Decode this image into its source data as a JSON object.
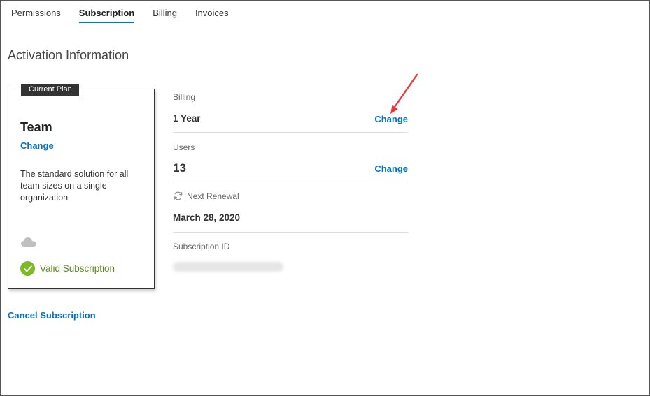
{
  "tabs": [
    {
      "label": "Permissions",
      "active": false
    },
    {
      "label": "Subscription",
      "active": true
    },
    {
      "label": "Billing",
      "active": false
    },
    {
      "label": "Invoices",
      "active": false
    }
  ],
  "page_title": "Activation Information",
  "plan_card": {
    "badge": "Current Plan",
    "name": "Team",
    "change_label": "Change",
    "description": "The standard solution for all team sizes on a single organization",
    "status_icon": "cloud-icon",
    "valid_label": "Valid Subscription"
  },
  "billing": {
    "label": "Billing",
    "value": "1 Year",
    "change_label": "Change"
  },
  "users": {
    "label": "Users",
    "value": "13",
    "change_label": "Change"
  },
  "renewal": {
    "label": "Next Renewal",
    "value": "March 28, 2020",
    "icon": "refresh-icon"
  },
  "subscription_id": {
    "label": "Subscription ID"
  },
  "cancel_label": "Cancel Subscription",
  "colors": {
    "accent": "#0072c6",
    "tab_underline": "#0078c8",
    "valid_green": "#7cbb26",
    "annotation_red": "#e8363c"
  }
}
